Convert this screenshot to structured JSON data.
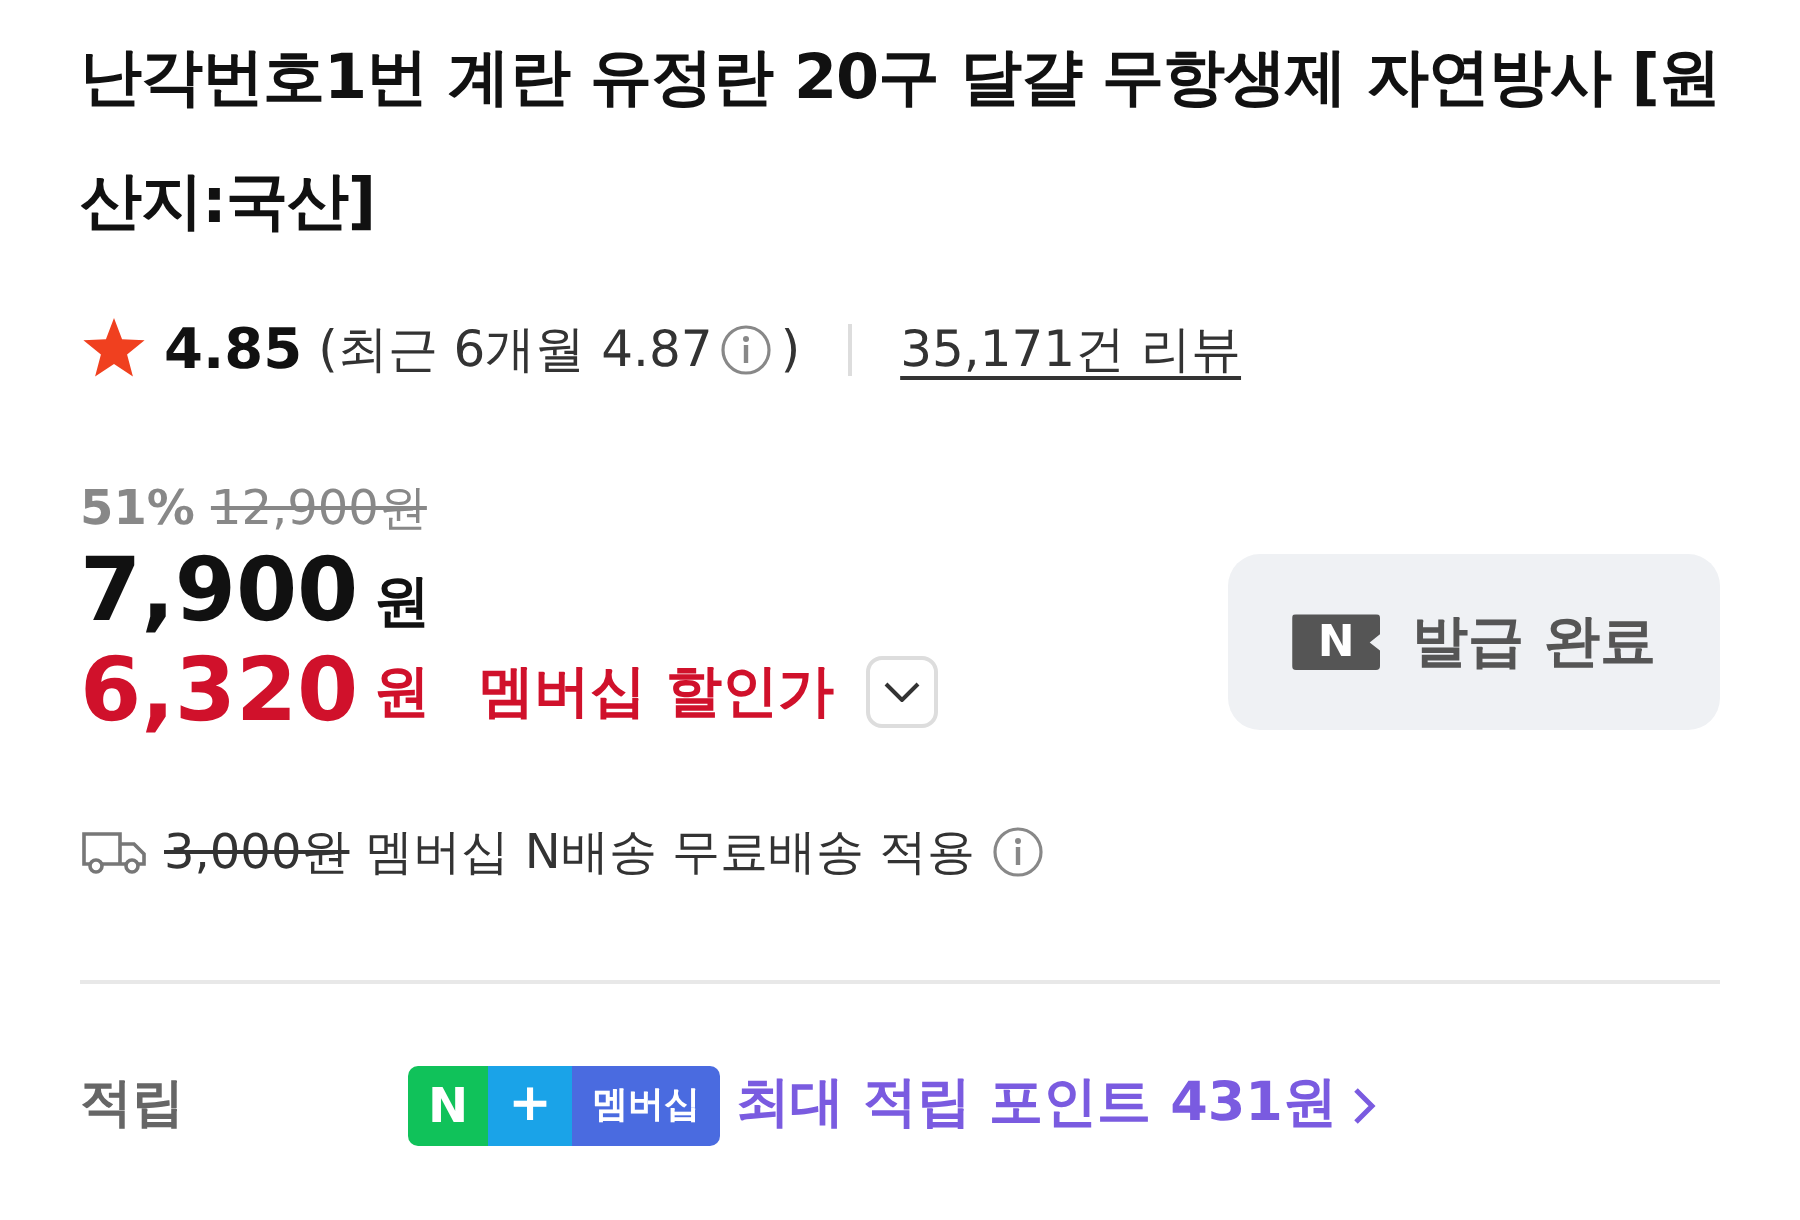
{
  "title": "난각번호1번 계란 유정란 20구 달걀 무항생제 자연방사 [원산지:국산]",
  "rating": {
    "score": "4.85",
    "recent": "(최근 6개월 4.87",
    "recent_close": ")",
    "reviews": "35,171건 리뷰"
  },
  "price": {
    "discount": "51%",
    "original": "12,900원",
    "sale": "7,900",
    "sale_unit": "원",
    "member": "6,320",
    "member_unit": "원",
    "member_label": "멤버십 할인가",
    "expanded": false
  },
  "coupon": {
    "icon_letter": "N",
    "label": "발급 완료"
  },
  "shipping": {
    "original_fee": "3,000원",
    "text": "멤버십 N배송 무료배송 적용"
  },
  "points": {
    "label": "적립",
    "badge": [
      "N",
      "+",
      "멤버십"
    ],
    "text": "최대 적립 포인트 431원"
  }
}
